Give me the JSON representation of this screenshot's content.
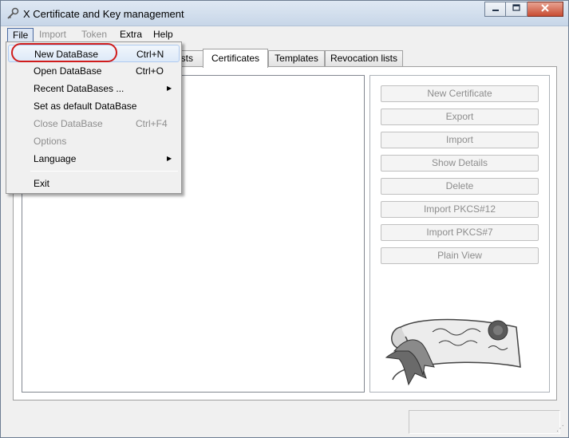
{
  "window": {
    "title": "X Certificate and Key management",
    "controls": {
      "minimize": "▭",
      "maximize": "▫",
      "close": "✕"
    }
  },
  "menubar": {
    "items": [
      {
        "label": "File",
        "enabled": true,
        "active": true
      },
      {
        "label": "Import",
        "enabled": false
      },
      {
        "label": "Token",
        "enabled": false
      },
      {
        "label": "Extra",
        "enabled": true
      },
      {
        "label": "Help",
        "enabled": true
      }
    ]
  },
  "file_menu": {
    "items": [
      {
        "label": "New DataBase",
        "shortcut": "Ctrl+N",
        "enabled": true,
        "highlighted": true
      },
      {
        "label": "Open DataBase",
        "shortcut": "Ctrl+O",
        "enabled": true
      },
      {
        "label": "Recent DataBases ...",
        "shortcut": "",
        "enabled": true,
        "submenu": true
      },
      {
        "label": "Set as default DataBase",
        "shortcut": "",
        "enabled": true
      },
      {
        "label": "Close DataBase",
        "shortcut": "Ctrl+F4",
        "enabled": false
      },
      {
        "label": "Options",
        "shortcut": "",
        "enabled": false
      },
      {
        "label": "Language",
        "shortcut": "",
        "enabled": true,
        "submenu": true
      },
      {
        "label": "Exit",
        "shortcut": "",
        "enabled": true
      }
    ]
  },
  "tabs": [
    {
      "label": "sts",
      "selected": false
    },
    {
      "label": "Certificates",
      "selected": true
    },
    {
      "label": "Templates",
      "selected": false
    },
    {
      "label": "Revocation lists",
      "selected": false
    }
  ],
  "certificates_panel": {
    "buttons": [
      "New Certificate",
      "Export",
      "Import",
      "Show Details",
      "Delete",
      "Import PKCS#12",
      "Import PKCS#7",
      "Plain View"
    ]
  },
  "annotation": {
    "color": "#d01c1c",
    "target": "New DataBase"
  },
  "icons": {
    "app": "key-icon",
    "submenu": "submenu-arrow-icon",
    "logo": "certificate-scroll-logo"
  }
}
